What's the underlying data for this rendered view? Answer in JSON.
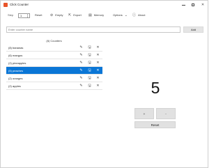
{
  "window": {
    "title": "Click Counter",
    "controls": {
      "minimize": "—",
      "maximize": "☐",
      "close": "✕"
    }
  },
  "toolbar": {
    "step_label": "Step",
    "step_value": "1",
    "reset_label": "Reset",
    "empty_label": "Empty",
    "export_label": "Export",
    "memory_label": "Memory",
    "options_label": "Options",
    "about_label": "About",
    "icons": {
      "reset": "↻",
      "empty": "⊘",
      "export": "⇱",
      "memory": "▤",
      "options": "⌄",
      "about": "ⓘ"
    }
  },
  "name_input": {
    "placeholder": "Enter counter name",
    "value": ""
  },
  "add_button": "Add",
  "list": {
    "header": "(6) Counters",
    "items": [
      {
        "label": "(8) bananas",
        "selected": false
      },
      {
        "label": "(6) mangos",
        "selected": false
      },
      {
        "label": "(2) pineapples",
        "selected": false
      },
      {
        "label": "(5) peaches",
        "selected": true
      },
      {
        "label": "(2) oranges",
        "selected": false
      },
      {
        "label": "(2) apples",
        "selected": false
      }
    ],
    "row_icons": {
      "edit": "✎",
      "save": "🖫",
      "delete": "✕"
    }
  },
  "counter_display": {
    "value": "5"
  },
  "buttons": {
    "plus": "+",
    "minus": "-",
    "reset": "Reset"
  },
  "colors": {
    "accent": "#0a76d6",
    "app_icon": "#e8542a"
  }
}
